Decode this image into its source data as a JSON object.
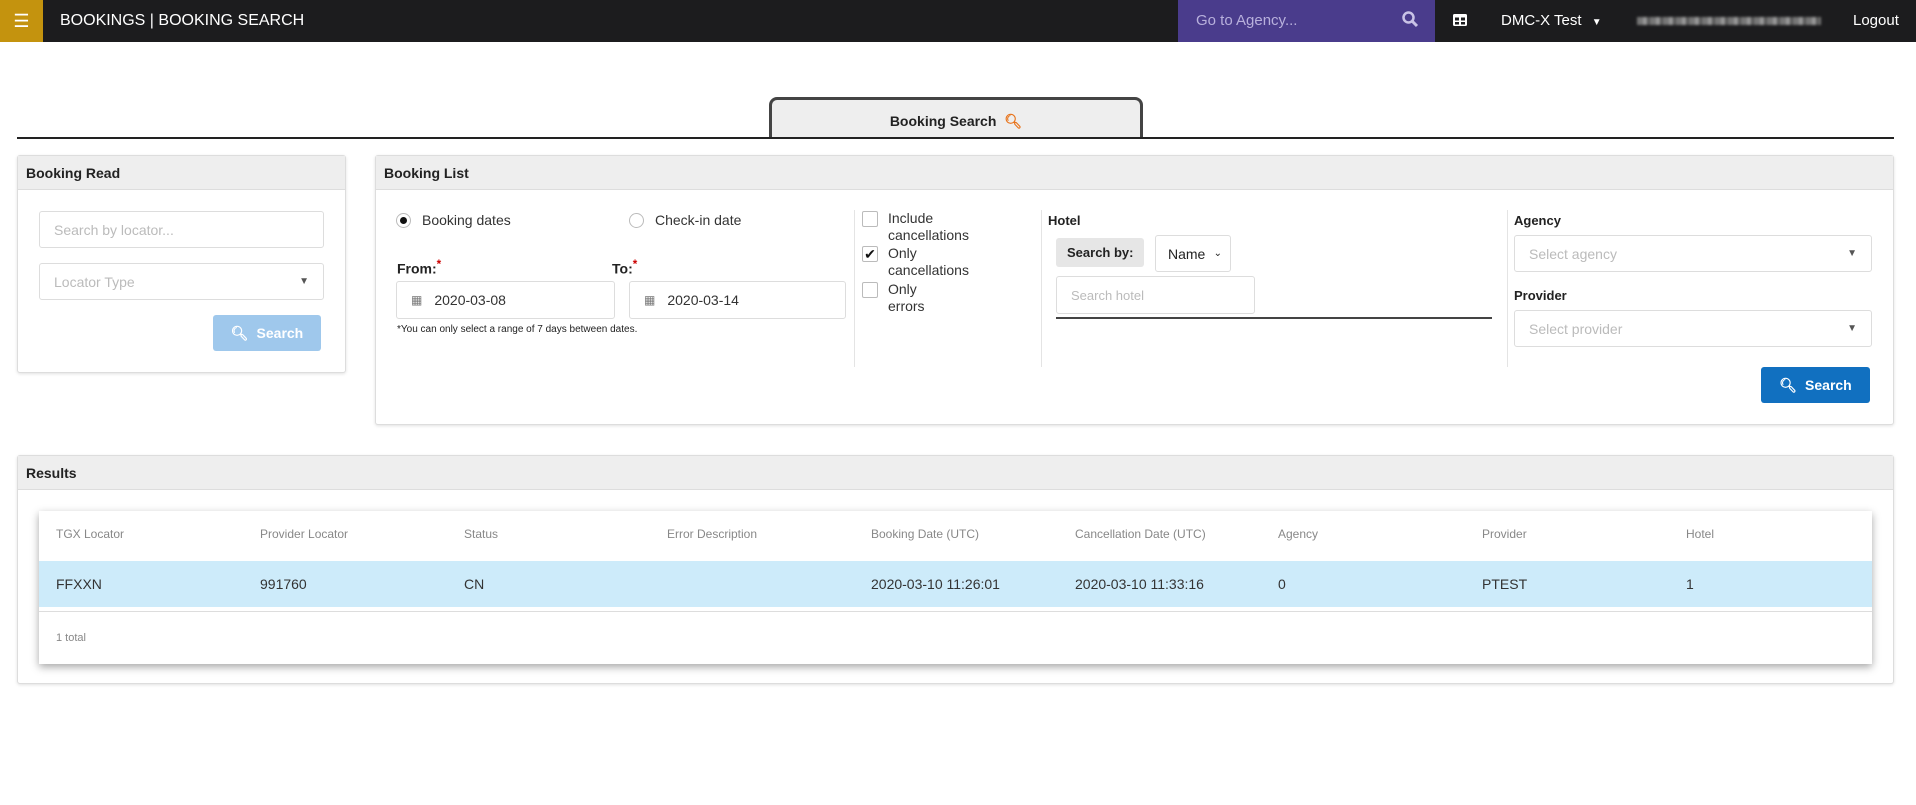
{
  "topbar": {
    "menu_icon": "hamburger-icon",
    "title": "BOOKINGS | BOOKING SEARCH",
    "agency_placeholder": "Go to Agency...",
    "workspace": "DMC-X Test",
    "logout": "Logout",
    "accent_menu": "#c4930e",
    "accent_agency": "#4a3c8c"
  },
  "tab": {
    "label": "Booking Search"
  },
  "booking_read": {
    "title": "Booking Read",
    "locator_placeholder": "Search by locator...",
    "locator_type_placeholder": "Locator Type",
    "search_label": "Search"
  },
  "booking_list": {
    "title": "Booking List",
    "radio_booking_dates": "Booking dates",
    "radio_checkin_date": "Check-in date",
    "selected_radio": "Booking dates",
    "from_label": "From:",
    "to_label": "To:",
    "required_mark": "*",
    "from_value": "2020-03-08",
    "to_value": "2020-03-14",
    "range_note": "*You can only select a range of 7 days between dates.",
    "checkboxes": [
      {
        "label1": "Include",
        "label2": "cancellations",
        "checked": false
      },
      {
        "label1": "Only",
        "label2": "cancellations",
        "checked": true
      },
      {
        "label1": "Only",
        "label2": "errors",
        "checked": false
      }
    ],
    "hotel_label": "Hotel",
    "search_by_label": "Search by:",
    "search_by_value": "Name",
    "hotel_placeholder": "Search hotel",
    "agency_label": "Agency",
    "agency_placeholder": "Select agency",
    "provider_label": "Provider",
    "provider_placeholder": "Select provider",
    "search_label": "Search",
    "search_color": "#1170c0"
  },
  "results": {
    "title": "Results",
    "columns": [
      "TGX Locator",
      "Provider Locator",
      "Status",
      "Error Description",
      "Booking Date (UTC)",
      "Cancellation Date (UTC)",
      "Agency",
      "Provider",
      "Hotel"
    ],
    "rows": [
      [
        "FFXXN",
        "991760",
        "CN",
        "",
        "2020-03-10 11:26:01",
        "2020-03-10 11:33:16",
        "0",
        "PTEST",
        "1"
      ]
    ],
    "total": "1 total",
    "row_highlight": "#cdebfa"
  }
}
